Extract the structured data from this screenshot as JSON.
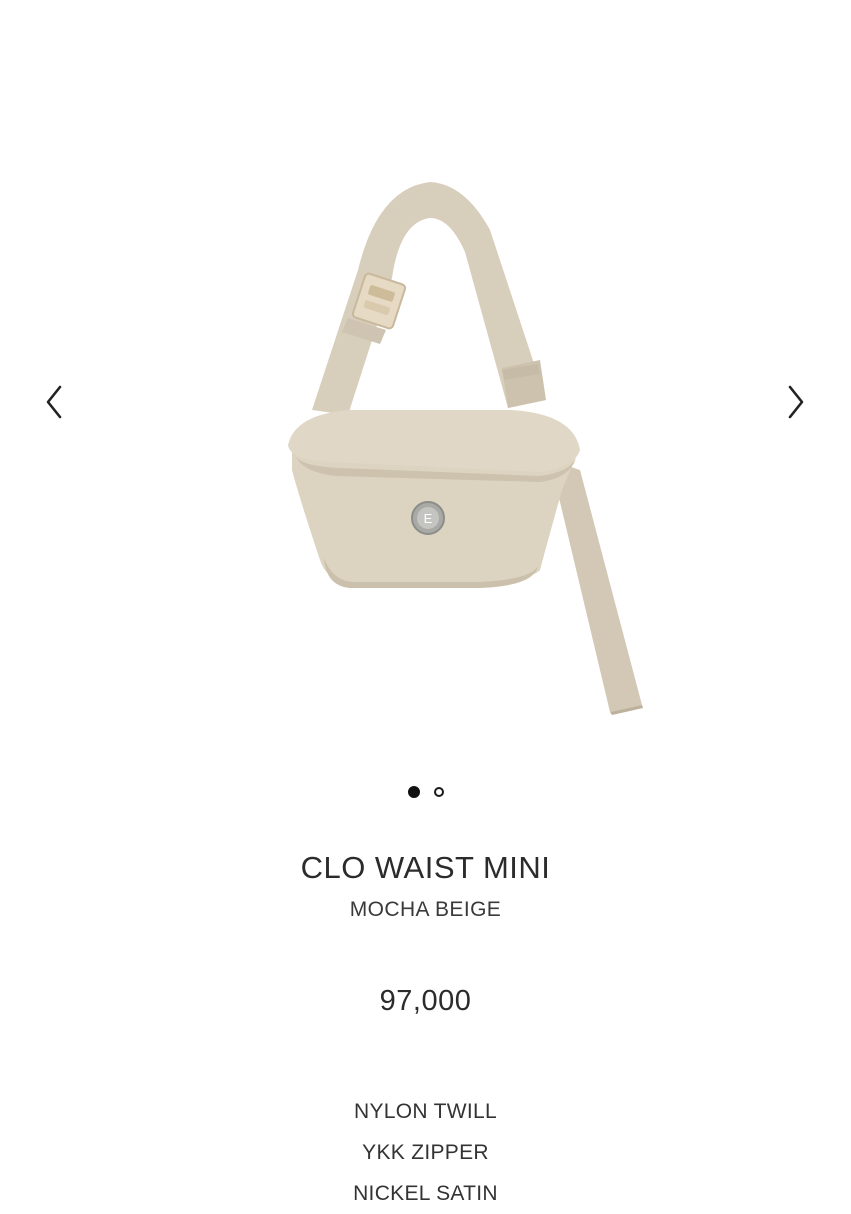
{
  "carousel": {
    "prev_icon": "chevron-left-icon",
    "next_icon": "chevron-right-icon",
    "slides_total": 2,
    "active_slide": 1
  },
  "product": {
    "name": "CLO WAIST MINI",
    "color_name": "MOCHA BEIGE",
    "price": "97,000",
    "specs": [
      "NYLON TWILL",
      "YKK ZIPPER",
      "NICKEL SATIN"
    ],
    "logo_letter": "E"
  },
  "colors": {
    "bag": "#ddd3c1",
    "bag_shadow": "#cfc4b0",
    "strap": "#d6ccba",
    "buckle": "#e3d6bf",
    "text": "#333333"
  }
}
